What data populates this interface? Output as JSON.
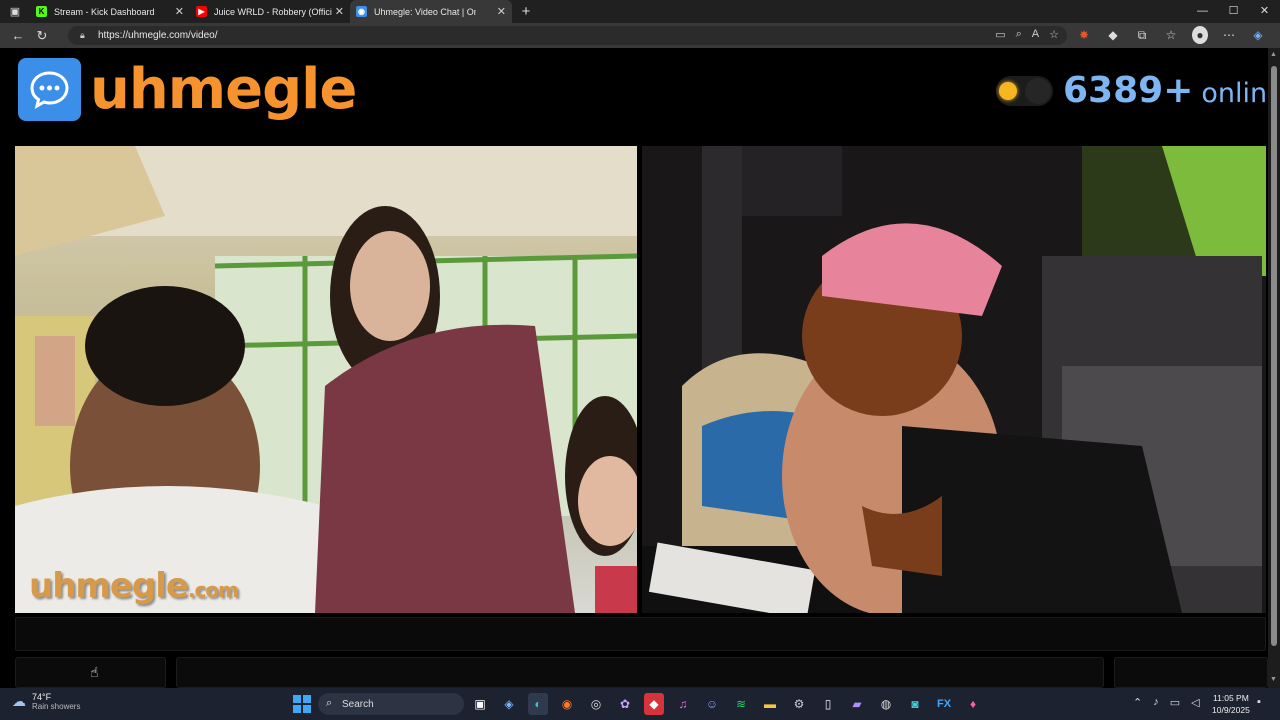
{
  "browser": {
    "tabs": [
      {
        "title": "Stream - Kick Dashboard",
        "icon": "kick-icon",
        "color": "#53fc18"
      },
      {
        "title": "Juice WRLD - Robbery (Official M",
        "icon": "youtube-icon",
        "color": "#ff0000"
      },
      {
        "title": "Uhmegle: Video Chat | Ome",
        "icon": "uhmegle-icon",
        "color": "#3b8fe8"
      }
    ],
    "new_tab": "+",
    "url": "https://uhmegle.com/video/",
    "window_controls": [
      "—",
      "☐",
      "✕"
    ]
  },
  "site": {
    "logo_text": "uhmegle",
    "online_count": "6389+",
    "online_label": "online",
    "watermark_main": "uhmegle",
    "watermark_tld": ".com",
    "brand_color": "#f7932e",
    "accent_color": "#7db6f2"
  },
  "taskbar": {
    "temperature": "74°F",
    "weather": "Rain showers",
    "search_placeholder": "Search",
    "time": "11:05 PM",
    "date": "10/9/2025"
  }
}
